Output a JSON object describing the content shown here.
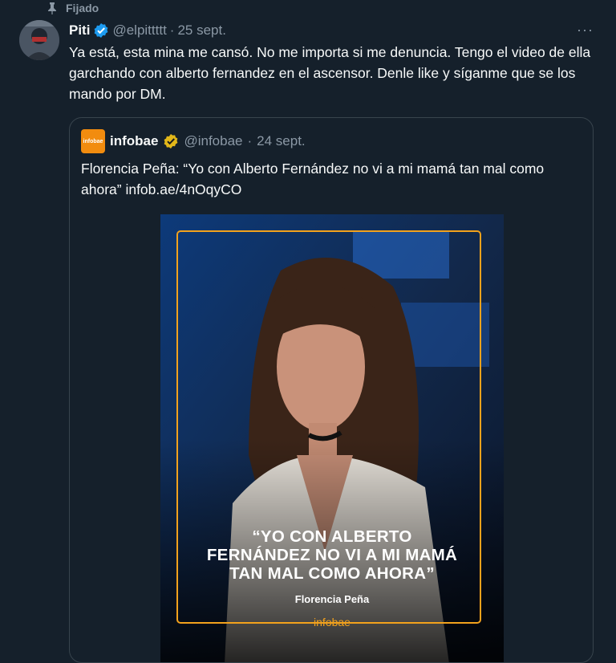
{
  "pinned": {
    "label": "Fijado"
  },
  "tweet": {
    "name": "Piti",
    "handle": "@elpittttt",
    "separator": "·",
    "date": "25 sept.",
    "more": "···",
    "text": "Ya está, esta mina me cansó. No me importa si me denuncia. Tengo el video de ella garchando con alberto fernandez en el ascensor. Denle like y síganme que se los mando por DM."
  },
  "quoted": {
    "avatar_text": "infobae",
    "name": "infobae",
    "handle": "@infobae",
    "separator": "·",
    "date": "24 sept.",
    "text": "Florencia Peña: “Yo con Alberto Fernández no vi a mi mamá tan mal como ahora” infob.ae/4nOqyCO",
    "media": {
      "quote_line1": "“YO CON ALBERTO",
      "quote_line2": "FERNÁNDEZ NO VI A MI MAMÁ",
      "quote_line3": "TAN MAL COMO AHORA”",
      "attribution": "Florencia Peña",
      "brand": "infobae"
    }
  },
  "colors": {
    "background": "#15202b",
    "text": "#f7f9f9",
    "muted": "#8b98a5",
    "verified_blue": "#1d9bf0",
    "verified_gold": "#e2b719",
    "brand_orange": "#f28c0f",
    "border": "#38444d"
  }
}
